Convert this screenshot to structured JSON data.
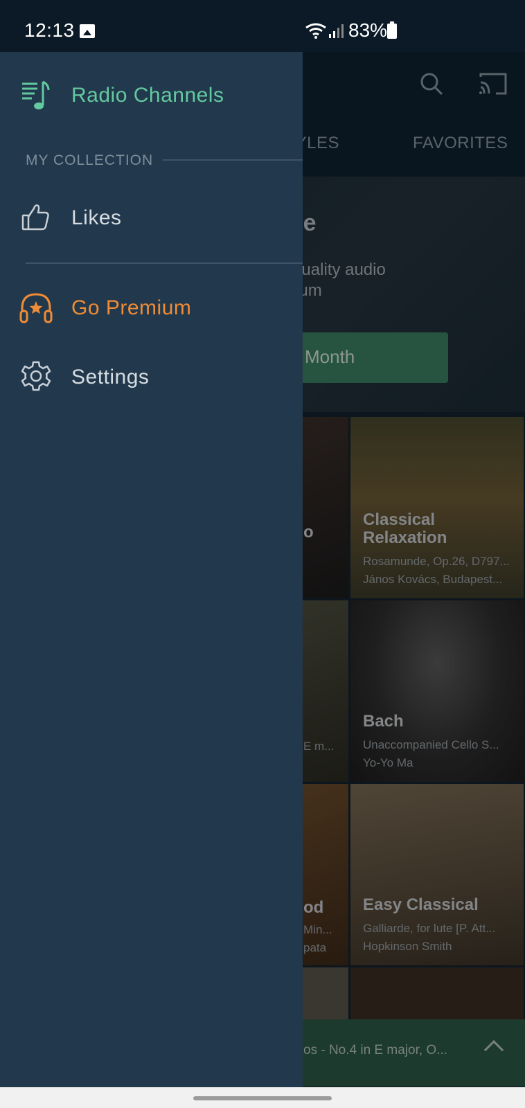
{
  "status_bar": {
    "time": "12:13",
    "battery": "83%"
  },
  "background": {
    "tabs": [
      "STYLES",
      "FAVORITES"
    ],
    "promo": {
      "title_visible": "for Free",
      "subtitle_line1": "the best quality audio",
      "subtitle_line2": "l of Premium",
      "button_label": "Month"
    },
    "cards": [
      {
        "title": "Classical Relaxation",
        "line1": "Rosamunde, Op.26, D797...",
        "line2": "János Kovács, Budapest..."
      },
      {
        "title": "Bach",
        "line1": "Unaccompanied Cello S...",
        "line2": "Yo-Yo Ma"
      },
      {
        "title": "Easy Classical",
        "line1": "Galliarde, for lute [P. Att...",
        "line2": "Hopkinson Smith"
      }
    ],
    "left_card_fragments": [
      "o",
      "E m...",
      "od",
      "Min...",
      "pata"
    ],
    "miniplayer_text": "os - No.4 in E major, O..."
  },
  "drawer": {
    "radio_channels": {
      "label": "Radio Channels",
      "icon": "music-list-icon",
      "color": "#63c9a0"
    },
    "section_header": "MY COLLECTION",
    "likes": {
      "label": "Likes",
      "icon": "thumbs-up-icon"
    },
    "go_premium": {
      "label": "Go Premium",
      "icon": "headphones-star-icon",
      "color": "#f08c35"
    },
    "settings": {
      "label": "Settings",
      "icon": "gear-icon"
    }
  },
  "colors": {
    "drawer_bg": "#22384c",
    "accent_green": "#63c9a0",
    "accent_orange": "#f08c35"
  }
}
